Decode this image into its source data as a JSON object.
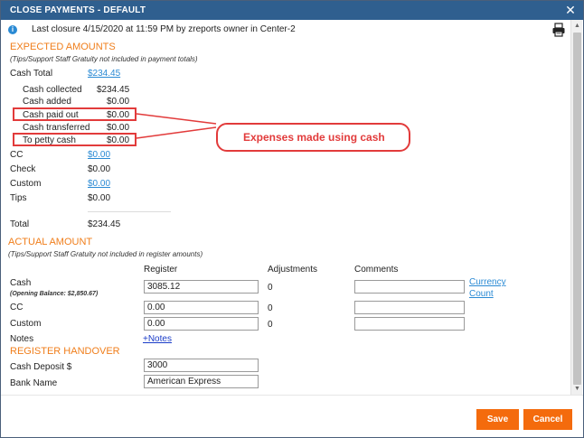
{
  "window": {
    "title": "CLOSE PAYMENTS - DEFAULT",
    "close_glyph": "✕"
  },
  "info": {
    "icon": "info-icon",
    "glyph": "i",
    "text": "Last closure 4/15/2020 at 11:59 PM by zreports owner in Center-2"
  },
  "print": {
    "icon": "printer-icon"
  },
  "expected": {
    "title": "EXPECTED AMOUNTS",
    "note": "(Tips/Support Staff Gratuity not included in payment totals)",
    "cash_total": {
      "label": "Cash Total",
      "value": "$234.45"
    },
    "cash_breakdown": [
      {
        "label": "Cash collected",
        "value": "$234.45"
      },
      {
        "label": "Cash added",
        "value": "$0.00"
      },
      {
        "label": "Cash paid out",
        "value": "$0.00"
      },
      {
        "label": "Cash transferred",
        "value": "$0.00"
      },
      {
        "label": "To petty cash",
        "value": "$0.00"
      }
    ],
    "others": [
      {
        "label": "CC",
        "value": "$0.00",
        "link": true
      },
      {
        "label": "Check",
        "value": "$0.00",
        "link": false
      },
      {
        "label": "Custom",
        "value": "$0.00",
        "link": true
      },
      {
        "label": "Tips",
        "value": "$0.00",
        "link": false
      }
    ],
    "total": {
      "label": "Total",
      "value": "$234.45"
    }
  },
  "annotation": {
    "callout_text": "Expenses made using cash",
    "color": "#e23b3b"
  },
  "actual": {
    "title": "ACTUAL AMOUNT",
    "note": "(Tips/Support Staff Gratuity not included in register amounts)",
    "headers": {
      "register": "Register",
      "adjustments": "Adjustments",
      "comments": "Comments"
    },
    "rows": [
      {
        "label": "Cash",
        "sub": "(Opening Balance: $2,850.67)",
        "register": "3085.12",
        "adjustment": "0",
        "comment": ""
      },
      {
        "label": "CC",
        "sub": "",
        "register": "0.00",
        "adjustment": "0",
        "comment": ""
      },
      {
        "label": "Custom",
        "sub": "",
        "register": "0.00",
        "adjustment": "0",
        "comment": ""
      }
    ],
    "currency_count_1": "Currency",
    "currency_count_2": "Count",
    "notes_label": "Notes",
    "notes_link": "+Notes"
  },
  "handover": {
    "title": "REGISTER HANDOVER",
    "deposit_label": "Cash Deposit $",
    "deposit_value": "3000",
    "bank_label": "Bank Name",
    "bank_value": "American Express"
  },
  "footer": {
    "save_label": "Save",
    "cancel_label": "Cancel",
    "accent": "#f46b0d"
  }
}
